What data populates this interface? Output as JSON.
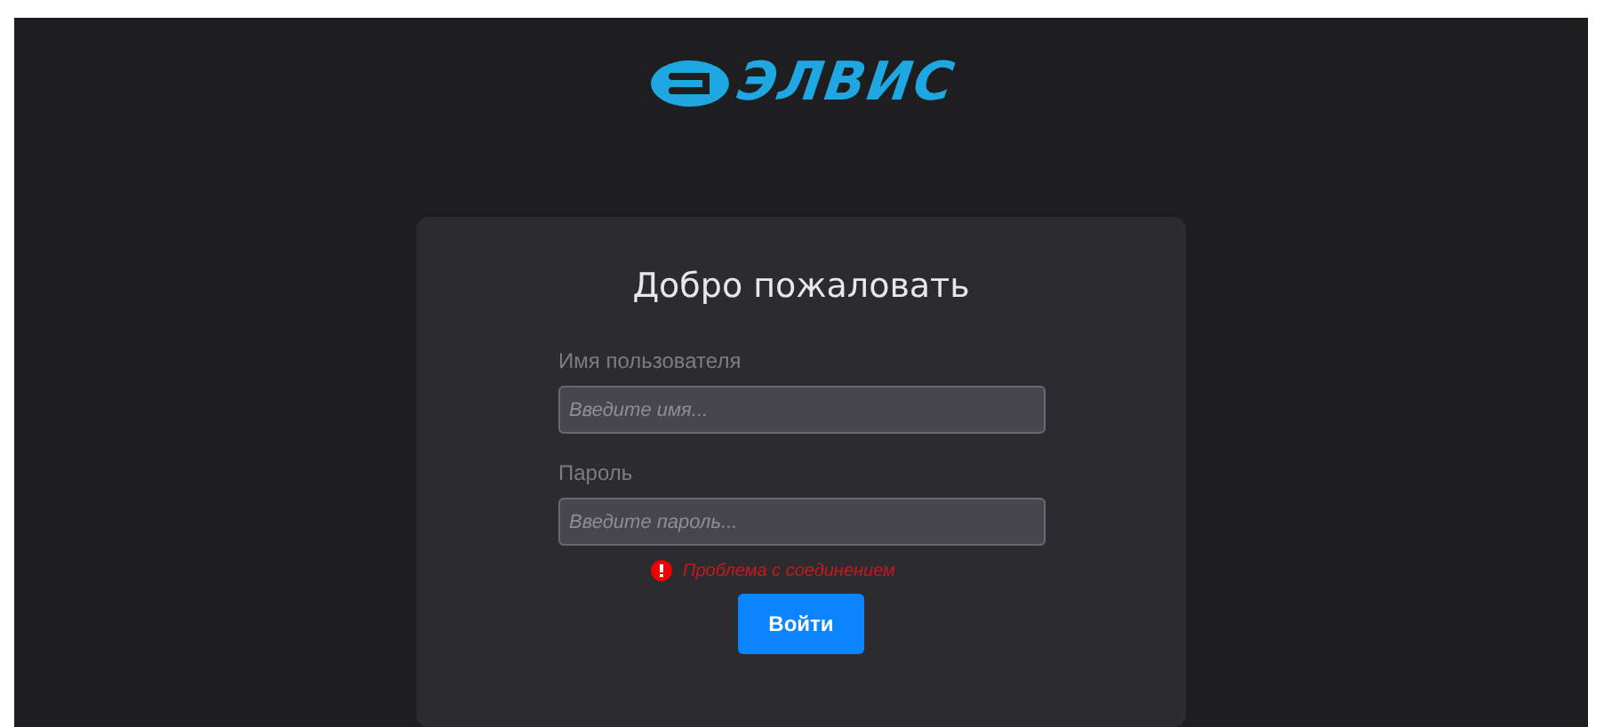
{
  "logo": {
    "text": "ЭЛВИС"
  },
  "login_card": {
    "title": "Добро пожаловать",
    "fields": [
      {
        "label": "Имя пользователя",
        "placeholder": "Введите имя..."
      },
      {
        "label": "Пароль",
        "placeholder": "Введите пароль..."
      }
    ],
    "error": "Проблема с соединением",
    "button": "Войти"
  }
}
